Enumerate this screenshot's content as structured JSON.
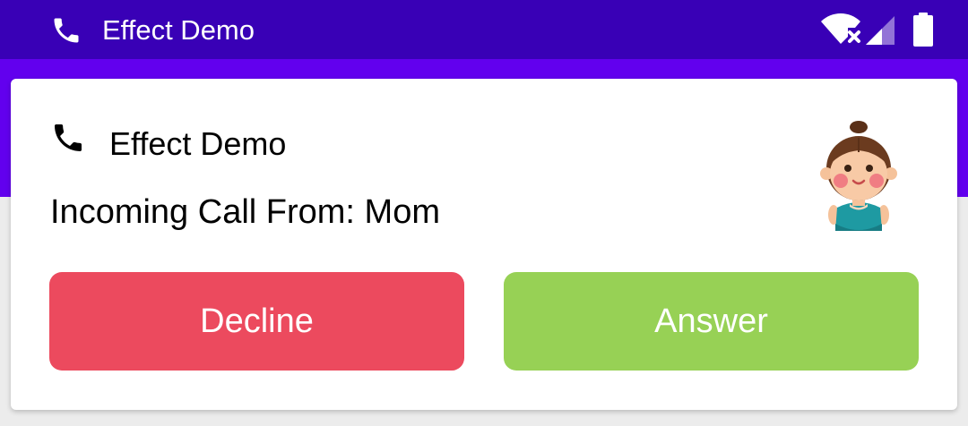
{
  "status_bar": {
    "app_name": "Effect Demo",
    "icons": [
      "phone-icon",
      "wifi-off-icon",
      "signal-icon",
      "battery-icon"
    ],
    "background_color": "#3900b6"
  },
  "app_bar": {
    "background_color": "#6200ee"
  },
  "notification": {
    "app_name": "Effect Demo",
    "message": "Incoming Call From: Mom",
    "avatar": "girl-avatar-icon",
    "actions": {
      "decline_label": "Decline",
      "answer_label": "Answer"
    },
    "colors": {
      "decline": "#ec4a5e",
      "answer": "#97d155"
    }
  }
}
